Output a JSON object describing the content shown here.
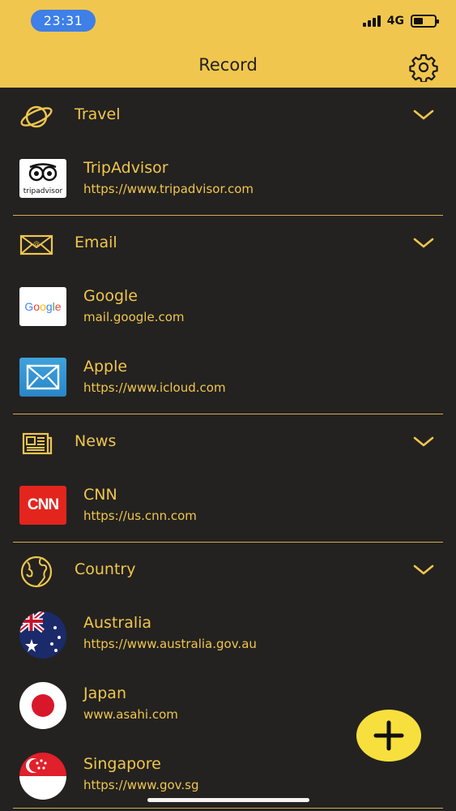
{
  "status": {
    "time": "23:31",
    "network": "4G",
    "battery_level": 0.45
  },
  "header": {
    "title": "Record"
  },
  "sections": [
    {
      "label": "Travel",
      "icon": "planet-icon",
      "items": [
        {
          "title": "TripAdvisor",
          "url": "https://www.tripadvisor.com",
          "logo_text": "tripadvisor"
        }
      ]
    },
    {
      "label": "Email",
      "icon": "envelope-icon",
      "items": [
        {
          "title": "Google",
          "url": "mail.google.com",
          "logo_text": "Google"
        },
        {
          "title": "Apple",
          "url": "https://www.icloud.com"
        }
      ]
    },
    {
      "label": "News",
      "icon": "newspaper-icon",
      "items": [
        {
          "title": "CNN",
          "url": "https://us.cnn.com",
          "logo_text": "CNN"
        }
      ]
    },
    {
      "label": "Country",
      "icon": "globe-icon",
      "items": [
        {
          "title": "Australia",
          "url": "https://www.australia.gov.au"
        },
        {
          "title": "Japan",
          "url": "www.asahi.com"
        },
        {
          "title": "Singapore",
          "url": "https://www.gov.sg"
        }
      ]
    }
  ],
  "colors": {
    "accent": "#f1c64e",
    "background": "#232220",
    "fab": "#f7e03d",
    "divider": "#d4ad4a"
  }
}
